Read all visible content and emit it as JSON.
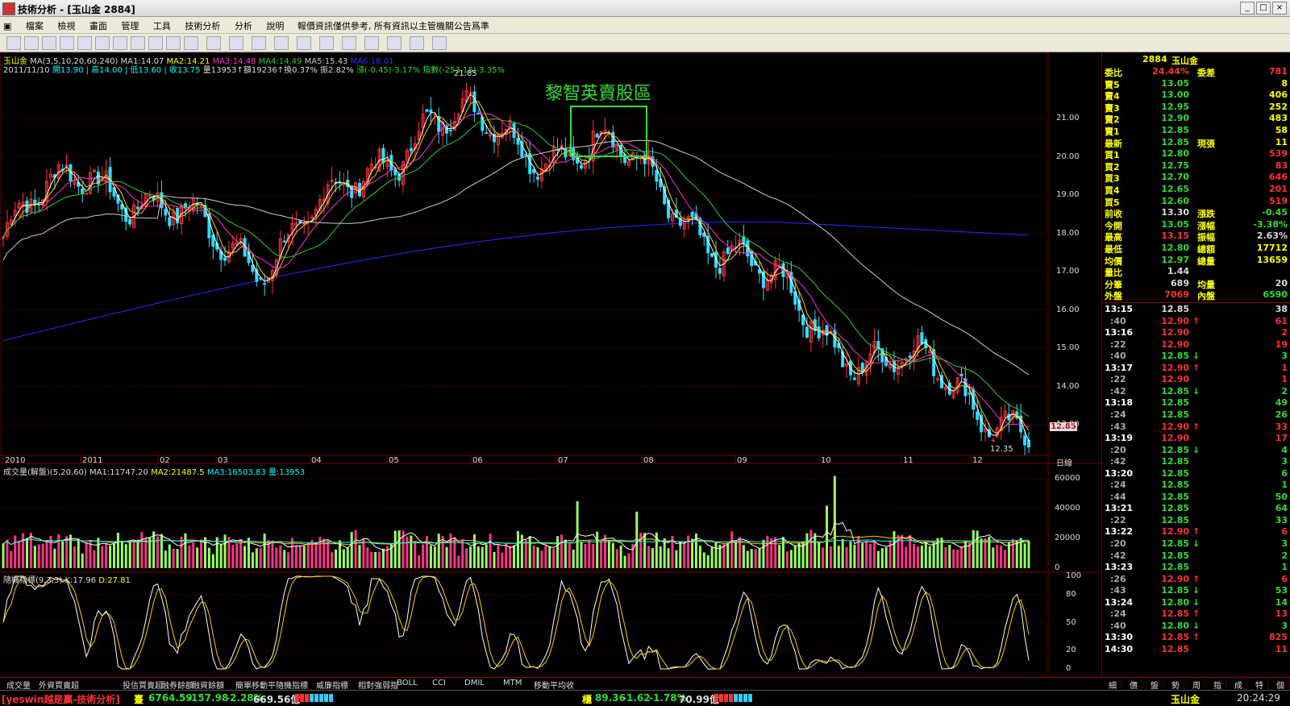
{
  "window": {
    "title": "技術分析 - [玉山金 2884]"
  },
  "menu": {
    "items": [
      "檔案",
      "檢視",
      "畫面",
      "管理",
      "工具",
      "技術分析",
      "分析",
      "說明"
    ],
    "notice": "報價資訊僅供參考, 所有資訊以主管機關公告爲準"
  },
  "colors": {
    "up": "#ff3333",
    "down": "#33dd33",
    "accent_cyan": "#00ffff",
    "accent_yellow": "#ffff00",
    "grid": "#7a0000",
    "blue_ma": "#2a2aff",
    "white_ma": "#cccccc",
    "magenta_ma": "#ff33cc",
    "green_ma": "#33cc33",
    "yellow_ma": "#ffcc00"
  },
  "main_chart": {
    "stock_label": "玉山金",
    "ma_header": "MA(3,5,10,20,60,240)",
    "ma_values": [
      "MA1:14.07",
      "MA2:14.21",
      "MA3:14.48",
      "MA4:14.49",
      "MA5:15.43",
      "MA6:18.01"
    ],
    "info_date": "2011/11/10",
    "info_ohlc": "開13.90 | 高14.00 | 低13.60 | 收13.75",
    "info_volume": "量13953↑額19236↑換0.37% 振2.82%",
    "info_change": "漲(-0.45)-3.17%",
    "info_index": "指數(-253.18)-3.35%",
    "annotation": "黎智英賣股區",
    "high_label": "21.85",
    "low_label": "12.35",
    "last_price_tag": "12.85",
    "y_ticks": [
      "21.00",
      "20.00",
      "19.00",
      "18.00",
      "17.00",
      "16.00",
      "15.00",
      "14.00",
      "13.00"
    ],
    "x_ticks": [
      "2010",
      "2011",
      "02",
      "03",
      "04",
      "05",
      "06",
      "07",
      "08",
      "09",
      "10",
      "11",
      "12"
    ],
    "period": "日線"
  },
  "volume_chart": {
    "header": "成交量(解盤)(5,20,60)",
    "ma_values": [
      "MA1:11747.20",
      "MA2:21487.5",
      "MA3:16503.83",
      "量:13953"
    ],
    "y_ticks": [
      "60000",
      "40000",
      "20000",
      "0"
    ]
  },
  "kd_chart": {
    "header": "隨機指標(9,3,3)",
    "k_value": "K:17.96",
    "d_value": "D:27.81",
    "y_ticks": [
      "100",
      "80",
      "50",
      "20",
      "0"
    ]
  },
  "chart_data": {
    "type": "candlestick",
    "approx_close_path": [
      [
        "2010-12",
        17.9
      ],
      [
        "2011-01",
        19.8
      ],
      [
        "2011-02",
        18.3
      ],
      [
        "2011-03",
        17.4
      ],
      [
        "2011-04",
        18.9
      ],
      [
        "2011-05",
        21.2
      ],
      [
        "2011-06",
        20.3
      ],
      [
        "2011-07",
        20.3
      ],
      [
        "2011-08",
        18.5
      ],
      [
        "2011-09",
        16.5
      ],
      [
        "2011-10",
        14.9
      ],
      [
        "2011-11",
        14.2
      ],
      [
        "2011-12",
        12.85
      ]
    ],
    "high": 21.85,
    "low": 12.35,
    "ylim": [
      12.2,
      22.2
    ]
  },
  "quote": {
    "code": "2884",
    "name": "玉山金",
    "weibi_label": "委比",
    "weibi_value": "24.44%",
    "weicha_label": "委差",
    "weicha_value": "781",
    "sells": [
      {
        "label": "賣5",
        "price": "13.05",
        "qty": "8"
      },
      {
        "label": "賣4",
        "price": "13.00",
        "qty": "406"
      },
      {
        "label": "賣3",
        "price": "12.95",
        "qty": "252"
      },
      {
        "label": "賣2",
        "price": "12.90",
        "qty": "483"
      },
      {
        "label": "賣1",
        "price": "12.85",
        "qty": "58"
      }
    ],
    "last_label": "最新",
    "last_price": "12.85",
    "cur_label": "現張",
    "cur_qty": "11",
    "buys": [
      {
        "label": "買1",
        "price": "12.80",
        "qty": "539"
      },
      {
        "label": "買2",
        "price": "12.75",
        "qty": "83"
      },
      {
        "label": "買3",
        "price": "12.70",
        "qty": "646"
      },
      {
        "label": "買4",
        "price": "12.65",
        "qty": "201"
      },
      {
        "label": "買5",
        "price": "12.60",
        "qty": "519"
      }
    ],
    "stats": [
      {
        "l1": "前收",
        "v1": "13.30",
        "l2": "漲跌",
        "v2": "-0.45"
      },
      {
        "l1": "今開",
        "v1": "13.05",
        "l2": "漲幅",
        "v2": "-3.38%"
      },
      {
        "l1": "最高",
        "v1": "13.15",
        "l2": "振幅",
        "v2": "2.63%"
      },
      {
        "l1": "最低",
        "v1": "12.80",
        "l2": "總額",
        "v2": "17712"
      },
      {
        "l1": "均價",
        "v1": "12.97",
        "l2": "總量",
        "v2": "13659"
      }
    ],
    "ratio_label": "量比",
    "ratio_value": "1.44",
    "fen_label": "分筆",
    "fen_value": "689",
    "junliang_label": "均量",
    "junliang_value": "20",
    "waipan_label": "外盤",
    "waipan_value": "7069",
    "neipan_label": "內盤",
    "neipan_value": "6590"
  },
  "ticks": [
    {
      "t": "13:15",
      "p": "12.85",
      "a": "",
      "q": "38",
      "c": "w"
    },
    {
      "t": ":40",
      "p": "12.90",
      "a": "↑",
      "q": "61",
      "c": "r"
    },
    {
      "t": "13:16",
      "p": "12.90",
      "a": "",
      "q": "2",
      "c": "r"
    },
    {
      "t": ":22",
      "p": "12.90",
      "a": "",
      "q": "19",
      "c": "r"
    },
    {
      "t": ":40",
      "p": "12.85",
      "a": "↓",
      "q": "3",
      "c": "g"
    },
    {
      "t": "13:17",
      "p": "12.90",
      "a": "↑",
      "q": "1",
      "c": "r"
    },
    {
      "t": ":22",
      "p": "12.90",
      "a": "",
      "q": "1",
      "c": "r"
    },
    {
      "t": ":42",
      "p": "12.85",
      "a": "↓",
      "q": "2",
      "c": "g"
    },
    {
      "t": "13:18",
      "p": "12.85",
      "a": "",
      "q": "49",
      "c": "g"
    },
    {
      "t": ":24",
      "p": "12.85",
      "a": "",
      "q": "26",
      "c": "g"
    },
    {
      "t": ":43",
      "p": "12.90",
      "a": "↑",
      "q": "33",
      "c": "r"
    },
    {
      "t": "13:19",
      "p": "12.90",
      "a": "",
      "q": "17",
      "c": "r"
    },
    {
      "t": ":20",
      "p": "12.85",
      "a": "↓",
      "q": "4",
      "c": "g"
    },
    {
      "t": ":42",
      "p": "12.85",
      "a": "",
      "q": "3",
      "c": "g"
    },
    {
      "t": "13:20",
      "p": "12.85",
      "a": "",
      "q": "6",
      "c": "g"
    },
    {
      "t": ":24",
      "p": "12.85",
      "a": "",
      "q": "1",
      "c": "g"
    },
    {
      "t": ":44",
      "p": "12.85",
      "a": "",
      "q": "50",
      "c": "g"
    },
    {
      "t": "13:21",
      "p": "12.85",
      "a": "",
      "q": "64",
      "c": "g"
    },
    {
      "t": ":22",
      "p": "12.85",
      "a": "",
      "q": "33",
      "c": "g"
    },
    {
      "t": "13:22",
      "p": "12.90",
      "a": "↑",
      "q": "6",
      "c": "r"
    },
    {
      "t": ":20",
      "p": "12.85",
      "a": "↓",
      "q": "3",
      "c": "g"
    },
    {
      "t": ":42",
      "p": "12.85",
      "a": "",
      "q": "2",
      "c": "g"
    },
    {
      "t": "13:23",
      "p": "12.85",
      "a": "",
      "q": "1",
      "c": "g"
    },
    {
      "t": ":26",
      "p": "12.90",
      "a": "↑",
      "q": "6",
      "c": "r"
    },
    {
      "t": ":43",
      "p": "12.85",
      "a": "↓",
      "q": "53",
      "c": "g"
    },
    {
      "t": "13:24",
      "p": "12.80",
      "a": "↓",
      "q": "14",
      "c": "g"
    },
    {
      "t": ":24",
      "p": "12.85",
      "a": "↑",
      "q": "13",
      "c": "r"
    },
    {
      "t": ":40",
      "p": "12.80",
      "a": "↓",
      "q": "3",
      "c": "g"
    },
    {
      "t": "13:30",
      "p": "12.85",
      "a": "↑",
      "q": "825",
      "c": "r"
    },
    {
      "t": "14:30",
      "p": "12.85",
      "a": "",
      "q": "11",
      "c": "r"
    }
  ],
  "bottom_tabs": [
    "成交量",
    "外資買賣超",
    "投信買賣超",
    "融券餘額",
    "融資餘額",
    "簡單移動平",
    "隨機指標",
    "威廉指標",
    "相對強弱指",
    "BOLL",
    "CCI",
    "DMIL",
    "MTM",
    "移動平均收"
  ],
  "right_tabs": [
    "細",
    "價",
    "盤",
    "勢",
    "周",
    "指",
    "成",
    "特",
    "個"
  ],
  "status": {
    "brand": "[yeswin越是贏-技術分析]",
    "idx1_label": "臺",
    "idx1_value": "6764.59",
    "idx1_change": "-157.98",
    "idx1_pct": "-2.28%",
    "idx1_amount": "669.56億",
    "idx2_label": "櫃",
    "idx2_value": "89.36",
    "idx2_change": "-1.62",
    "idx2_pct": "-1.78%",
    "idx2_amount": "70.99億",
    "ticker": "玉山金",
    "clock": "20:24:29"
  }
}
